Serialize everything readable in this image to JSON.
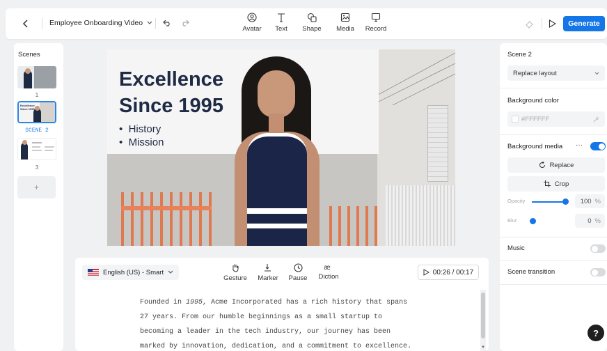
{
  "topbar": {
    "project_title": "Employee Onboarding Video",
    "tools": [
      {
        "label": "Avatar",
        "icon": "avatar-icon"
      },
      {
        "label": "Text",
        "icon": "text-icon"
      },
      {
        "label": "Shape",
        "icon": "shape-icon"
      },
      {
        "label": "Media",
        "icon": "media-icon"
      },
      {
        "label": "Record",
        "icon": "record-icon"
      }
    ],
    "generate_label": "Generate"
  },
  "scenes": {
    "title": "Scenes",
    "items": [
      {
        "number": "1"
      },
      {
        "number": "SCENE 2",
        "active": true
      },
      {
        "number": "3"
      }
    ],
    "add_label": "+"
  },
  "canvas": {
    "headline_line1": "Excellence",
    "headline_line2": "Since 1995",
    "bullets": [
      "History",
      "Mission"
    ],
    "thumb_title": "Excellence Since 1995"
  },
  "script": {
    "language": "English (US) - Smart",
    "tools": [
      {
        "label": "Gesture",
        "icon": "hand-gesture-icon"
      },
      {
        "label": "Marker",
        "icon": "marker-icon"
      },
      {
        "label": "Pause",
        "icon": "clock-icon"
      },
      {
        "label": "Diction",
        "icon": "diction-icon"
      }
    ],
    "timer": "00:26 / 00:17",
    "text_pre": "Founded in ",
    "text_em": "1995",
    "text_post": ", Acme Incorporated has a rich history that spans",
    "lines": [
      "27 years. From our humble beginnings as a small startup to",
      "becoming a leader in the tech industry, our journey has been",
      "marked by innovation, dedication, and a commitment to excellence."
    ]
  },
  "props": {
    "scene_title": "Scene 2",
    "layout_select": "Replace layout",
    "bg_color_label": "Background color",
    "bg_color_value": "#FFFFFF",
    "bg_media_label": "Background media",
    "more": "···",
    "replace_label": "Replace",
    "crop_label": "Crop",
    "opacity_label": "Opacity",
    "opacity_value": "100",
    "blur_label": "Blur",
    "blur_value": "0",
    "unit": "%",
    "music_label": "Music",
    "transition_label": "Scene transition",
    "bg_media_on": true,
    "music_on": false,
    "transition_on": false
  },
  "help_label": "?",
  "colors": {
    "accent": "#1576e8",
    "scene_active": "#2a86e8"
  }
}
